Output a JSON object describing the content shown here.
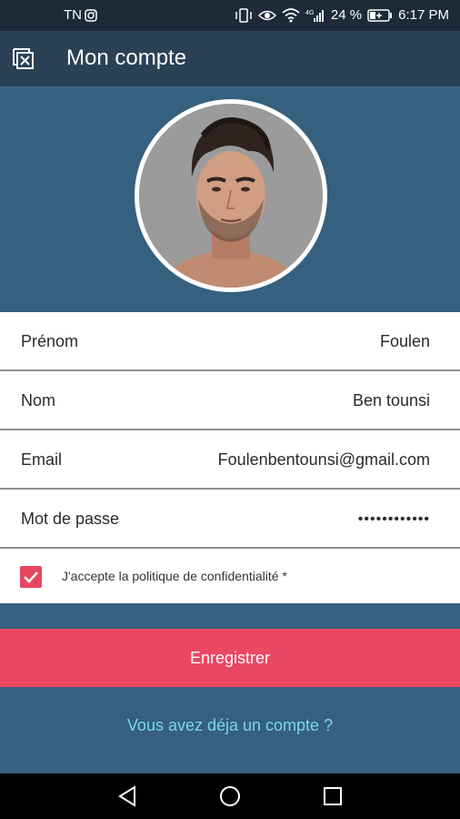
{
  "status_bar": {
    "carrier": "TN",
    "battery": "24 %",
    "time": "6:17 PM",
    "icons": [
      "instagram-icon",
      "vibrate-icon",
      "eye-icon",
      "wifi-icon",
      "signal-icon",
      "battery-icon"
    ]
  },
  "app_bar": {
    "title": "Mon compte",
    "back_icon": "close-box-icon"
  },
  "profile": {
    "avatar": "profile-photo"
  },
  "form": {
    "fields": [
      {
        "label": "Prénom",
        "value": "Foulen"
      },
      {
        "label": "Nom",
        "value": "Ben tounsi"
      },
      {
        "label": "Email",
        "value": "Foulenbentounsi@gmail.com"
      },
      {
        "label": "Mot de passe",
        "value": "••••••••••••"
      }
    ],
    "consent": {
      "checked": true,
      "label": "J'accepte la politique de confidentialité *"
    }
  },
  "actions": {
    "save_label": "Enregistrer",
    "login_link": "Vous avez déja un compte ?"
  },
  "colors": {
    "statusbar": "#1d2b38",
    "appbar": "#2a4155",
    "background": "#36607f",
    "accent": "#ea4763",
    "link": "#7ad4ee"
  },
  "nav_bar": {
    "icons": [
      "back-triangle-icon",
      "home-circle-icon",
      "recents-square-icon"
    ]
  }
}
